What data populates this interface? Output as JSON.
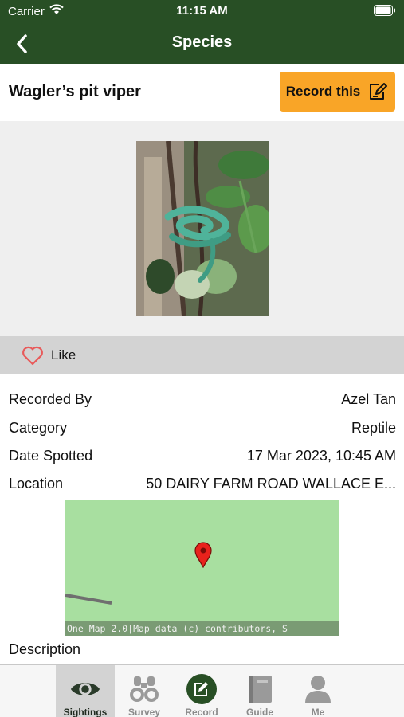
{
  "status_bar": {
    "carrier": "Carrier",
    "time": "11:15 AM"
  },
  "nav": {
    "title": "Species"
  },
  "header": {
    "species_name": "Wagler’s pit viper",
    "record_button_label": "Record this"
  },
  "like": {
    "label": "Like"
  },
  "details": [
    {
      "label": "Recorded By",
      "value": "Azel Tan"
    },
    {
      "label": "Category",
      "value": "Reptile"
    },
    {
      "label": "Date Spotted",
      "value": "17 Mar 2023, 10:45 AM"
    },
    {
      "label": "Location",
      "value": "50 DAIRY FARM ROAD WALLACE E..."
    }
  ],
  "map": {
    "attribution": "One Map 2.0|Map data (c) contributors, S"
  },
  "description_label": "Description",
  "tabs": [
    {
      "label": "Sightings",
      "icon": "eye-icon",
      "active": true
    },
    {
      "label": "Survey",
      "icon": "binoculars-icon",
      "active": false
    },
    {
      "label": "Record",
      "icon": "record-icon",
      "active": false
    },
    {
      "label": "Guide",
      "icon": "book-icon",
      "active": false
    },
    {
      "label": "Me",
      "icon": "person-icon",
      "active": false
    }
  ],
  "colors": {
    "header_bg": "#284f25",
    "accent_orange": "#f9a527",
    "like_bar_bg": "#d3d3d3",
    "map_green": "#a8dfa0",
    "pin_red": "#e8221c"
  }
}
